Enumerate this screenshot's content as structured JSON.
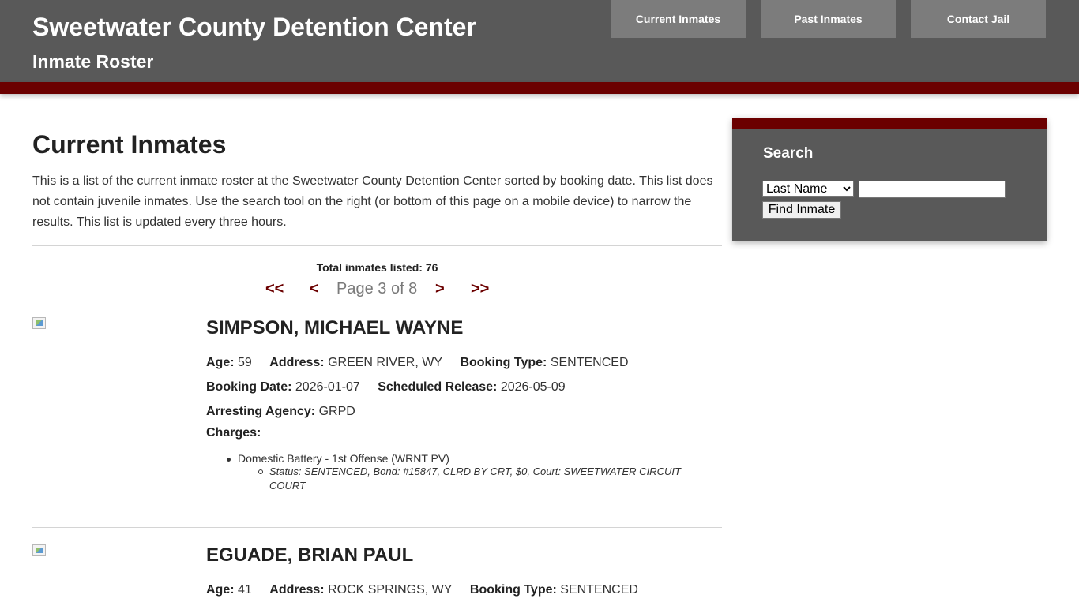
{
  "header": {
    "title": "Sweetwater County Detention Center",
    "subtitle": "Inmate Roster",
    "nav": [
      "Current Inmates",
      "Past Inmates",
      "Contact Jail"
    ]
  },
  "main": {
    "heading": "Current Inmates",
    "intro": "This is a list of the current inmate roster at the Sweetwater County Detention Center sorted by booking date. This list does not contain juvenile inmates. Use the search tool on the right (or bottom of this page on a mobile device) to narrow the results. This list is updated every three hours.",
    "total_label": "Total inmates listed: 76",
    "pager": {
      "first": "<<",
      "prev": "<",
      "label": "Page 3 of 8",
      "next": ">",
      "last": ">>"
    }
  },
  "labels": {
    "age": "Age:",
    "address": "Address:",
    "booking_type": "Booking Type:",
    "booking_date": "Booking Date:",
    "scheduled_release": "Scheduled Release:",
    "arresting_agency": "Arresting Agency:",
    "charges": "Charges:"
  },
  "inmates": [
    {
      "name": "SIMPSON, MICHAEL WAYNE",
      "age": "59",
      "address": "GREEN RIVER, WY",
      "booking_type": "SENTENCED",
      "booking_date": "2026-01-07",
      "scheduled_release": "2026-05-09",
      "arresting_agency": "GRPD",
      "charges": [
        {
          "charge": "Domestic Battery - 1st Offense (WRNT PV)",
          "status": "Status: SENTENCED, Bond: #15847, CLRD BY CRT, $0, Court: SWEETWATER CIRCUIT COURT"
        }
      ]
    },
    {
      "name": "EGUADE, BRIAN PAUL",
      "age": "41",
      "address": "ROCK SPRINGS, WY",
      "booking_type": "SENTENCED"
    }
  ],
  "search": {
    "title": "Search",
    "select_value": "Last Name",
    "select_options": [
      "Last Name"
    ],
    "input_value": "",
    "button_label": "Find Inmate"
  },
  "colors": {
    "header_bg": "#595959",
    "accent": "#6b0000",
    "nav_button": "#7c7c7c"
  },
  "icons": [
    "broken-image-icon"
  ]
}
